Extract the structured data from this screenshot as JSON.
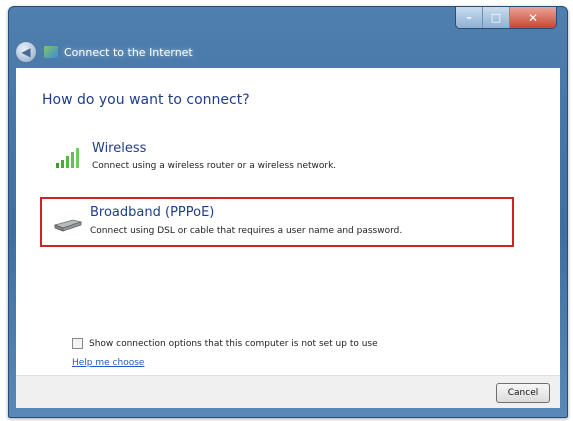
{
  "window": {
    "title": "Connect to the Internet",
    "caption": {
      "minimize": "–",
      "maximize": "□",
      "close": "✕"
    }
  },
  "main": {
    "heading": "How do you want to connect?",
    "options": [
      {
        "title": "Wireless",
        "description": "Connect using a wireless router or a wireless network.",
        "icon": "wireless-signal-icon",
        "highlighted": false
      },
      {
        "title": "Broadband (PPPoE)",
        "description": "Connect using DSL or cable that requires a user name and password.",
        "icon": "broadband-modem-icon",
        "highlighted": true
      }
    ],
    "show_options_label": "Show connection options that this computer is not set up to use",
    "show_options_checked": false,
    "help_link": "Help me choose"
  },
  "footer": {
    "cancel_label": "Cancel"
  },
  "colors": {
    "highlight_border": "#d21f2a",
    "heading_text": "#1e3e8a",
    "link": "#2a57c7",
    "titlebar": "#4f7fae"
  }
}
